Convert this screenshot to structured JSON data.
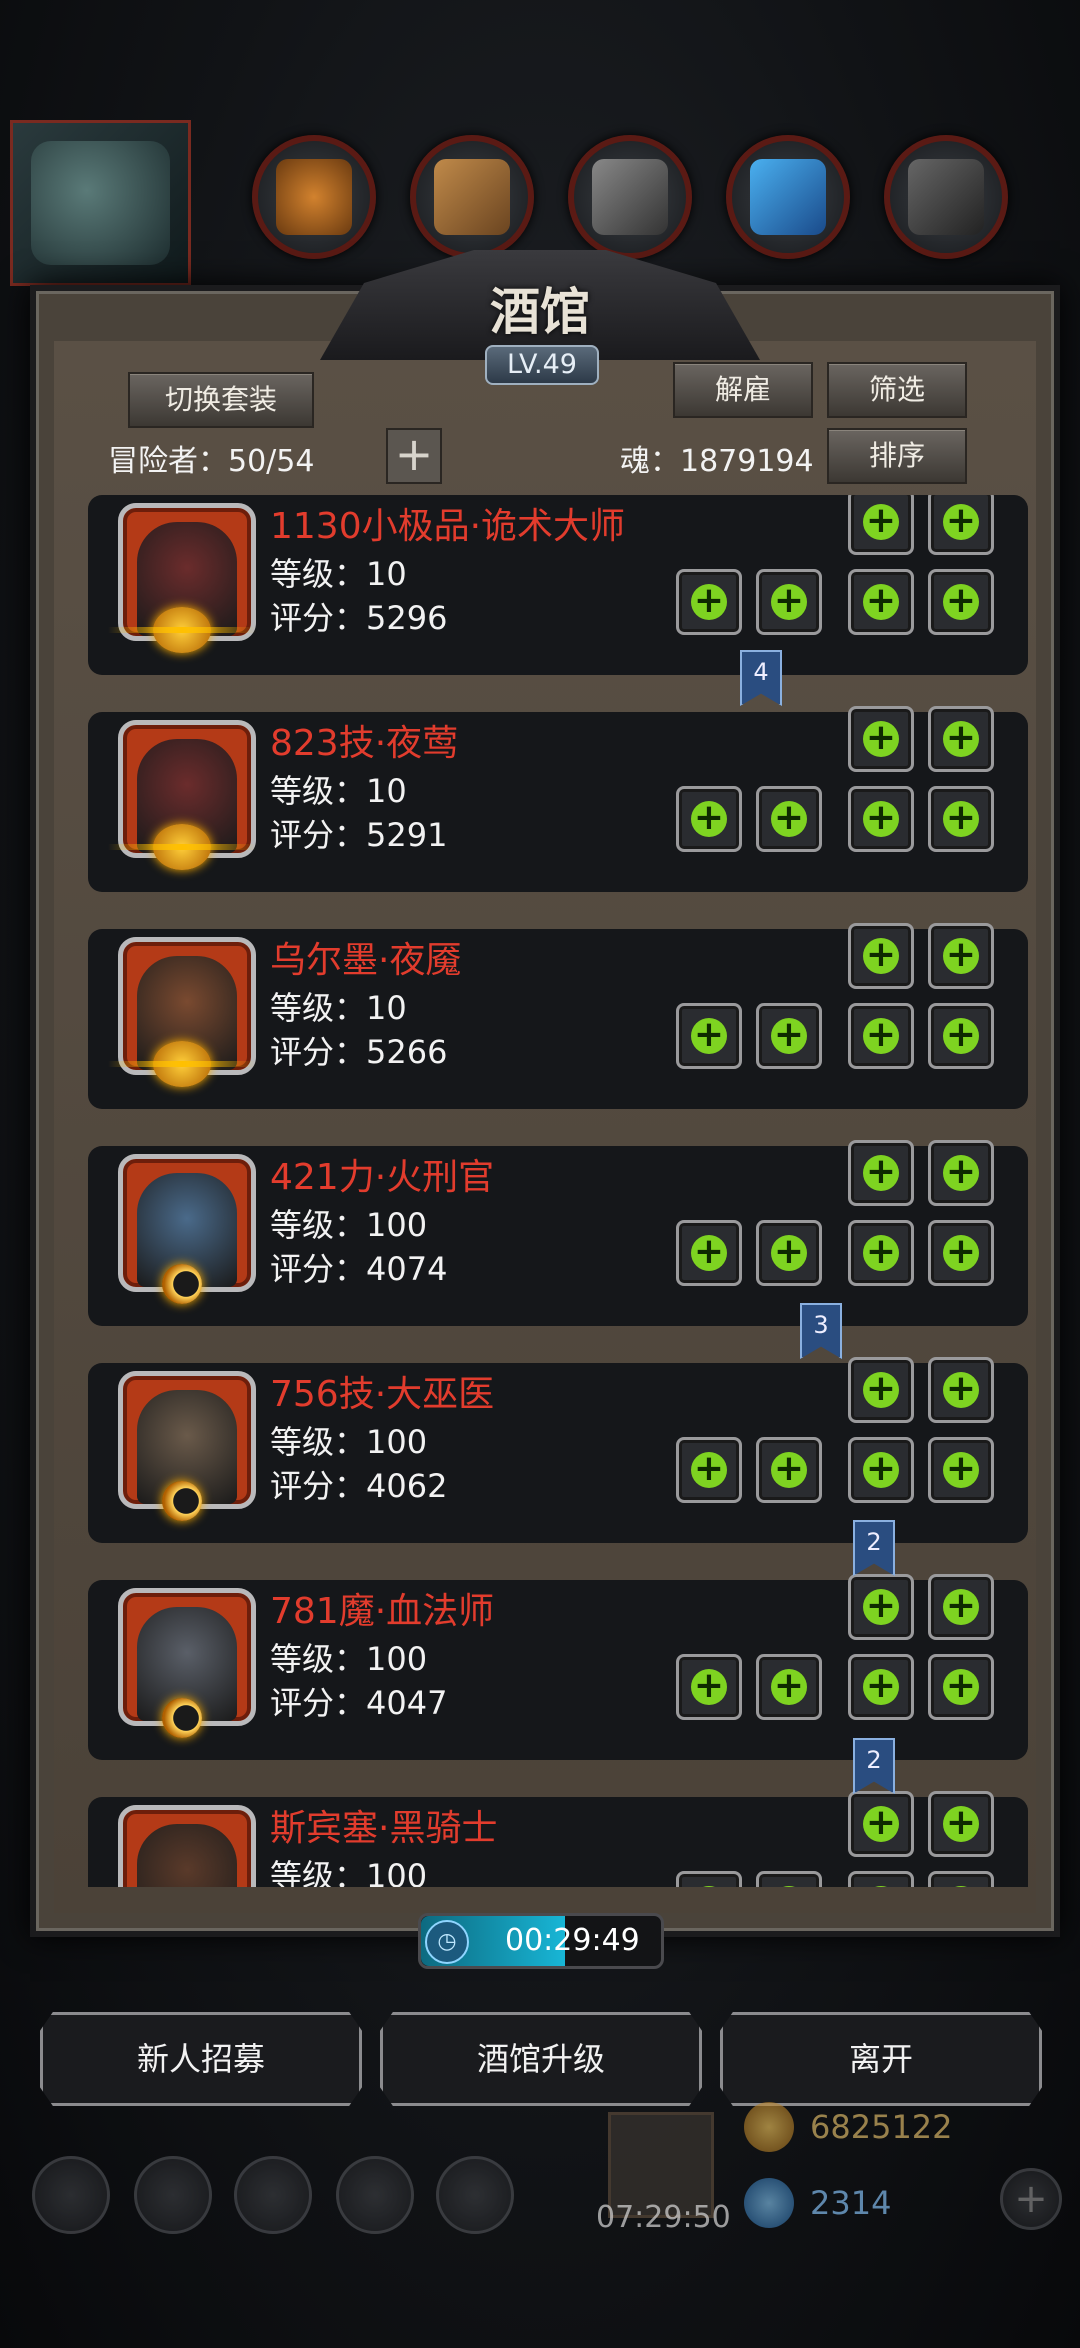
{
  "header": {
    "title": "酒馆",
    "level": "LV.49",
    "switch_outfit": "切换套装",
    "dismiss": "解雇",
    "filter": "筛选",
    "sort": "排序",
    "adventurer_label": "冒险者：50/54",
    "soul_label": "魂：1879194",
    "add_icon": "+"
  },
  "heroes": [
    {
      "name": "1130小极品·诡术大师",
      "level": "等级：10",
      "score": "评分：5296",
      "badge": "gold",
      "face": "#6b2c2c"
    },
    {
      "name": "823技·夜莺",
      "level": "等级：10",
      "score": "评分：5291",
      "badge": "gold",
      "face": "#6b2c2c"
    },
    {
      "name": "乌尔墨·夜魇",
      "level": "等级：10",
      "score": "评分：5266",
      "badge": "gold",
      "face": "#7a4a30"
    },
    {
      "name": "421力·火刑官",
      "level": "等级：100",
      "score": "评分：4074",
      "badge": "moon",
      "face": "#4a6a8a"
    },
    {
      "name": "756技·大巫医",
      "level": "等级：100",
      "score": "评分：4062",
      "badge": "moon",
      "face": "#6a5a4a"
    },
    {
      "name": "781魔·血法师",
      "level": "等级：100",
      "score": "评分：4047",
      "badge": "moon",
      "face": "#5a5f68"
    },
    {
      "name": "斯宾塞·黑骑士",
      "level": "等级：100",
      "score": "",
      "badge": "moon",
      "face": "#5a3a2a"
    }
  ],
  "ribbons": [
    "4",
    "3",
    "2",
    "2"
  ],
  "timer": "00:29:49",
  "actions": {
    "recruit": "新人招募",
    "upgrade": "酒馆升级",
    "leave": "离开"
  },
  "bottom": {
    "timer": "07:29:50",
    "gold": "6825122",
    "gems": "2314"
  },
  "colors": {
    "hero_name": "#e23c2d",
    "plus_green": "#7ed321",
    "panel": "#4a433a"
  }
}
